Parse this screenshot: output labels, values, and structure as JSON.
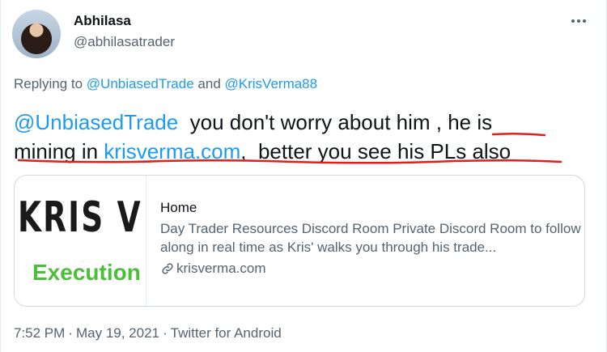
{
  "tweet": {
    "author": {
      "display_name": "Abhilasa",
      "handle": "@abhilasatrader"
    },
    "replying": {
      "prefix": "Replying to",
      "mention1": "@UnbiasedTrade",
      "conjunction": "and",
      "mention2": "@KrisVerma88"
    },
    "body": {
      "mention": "@UnbiasedTrade",
      "part1": "  you don't worry about him , he is",
      "part2": "mining in ",
      "link": "krisverma.com",
      "part3": ",  better you see his PLs also"
    },
    "link_card": {
      "thumbnail_text_top": "KRIS V",
      "thumbnail_text_bottom": "Execution",
      "title": "Home",
      "description": "Day Trader Resources Discord Room Private Discord Room to follow along in real time as Kris' walks you through his trade...",
      "domain": "krisverma.com"
    },
    "meta": {
      "time": "7:52 PM",
      "separator": "·",
      "date": "May 19, 2021",
      "source": "Twitter for Android"
    },
    "icons": {
      "more": "more-horizontal-icon",
      "link": "link-icon"
    },
    "colors": {
      "link": "#1d9bf0",
      "secondary": "#536471",
      "annotation_red": "#e0201b",
      "thumbnail_green": "#4cbf3a"
    }
  }
}
